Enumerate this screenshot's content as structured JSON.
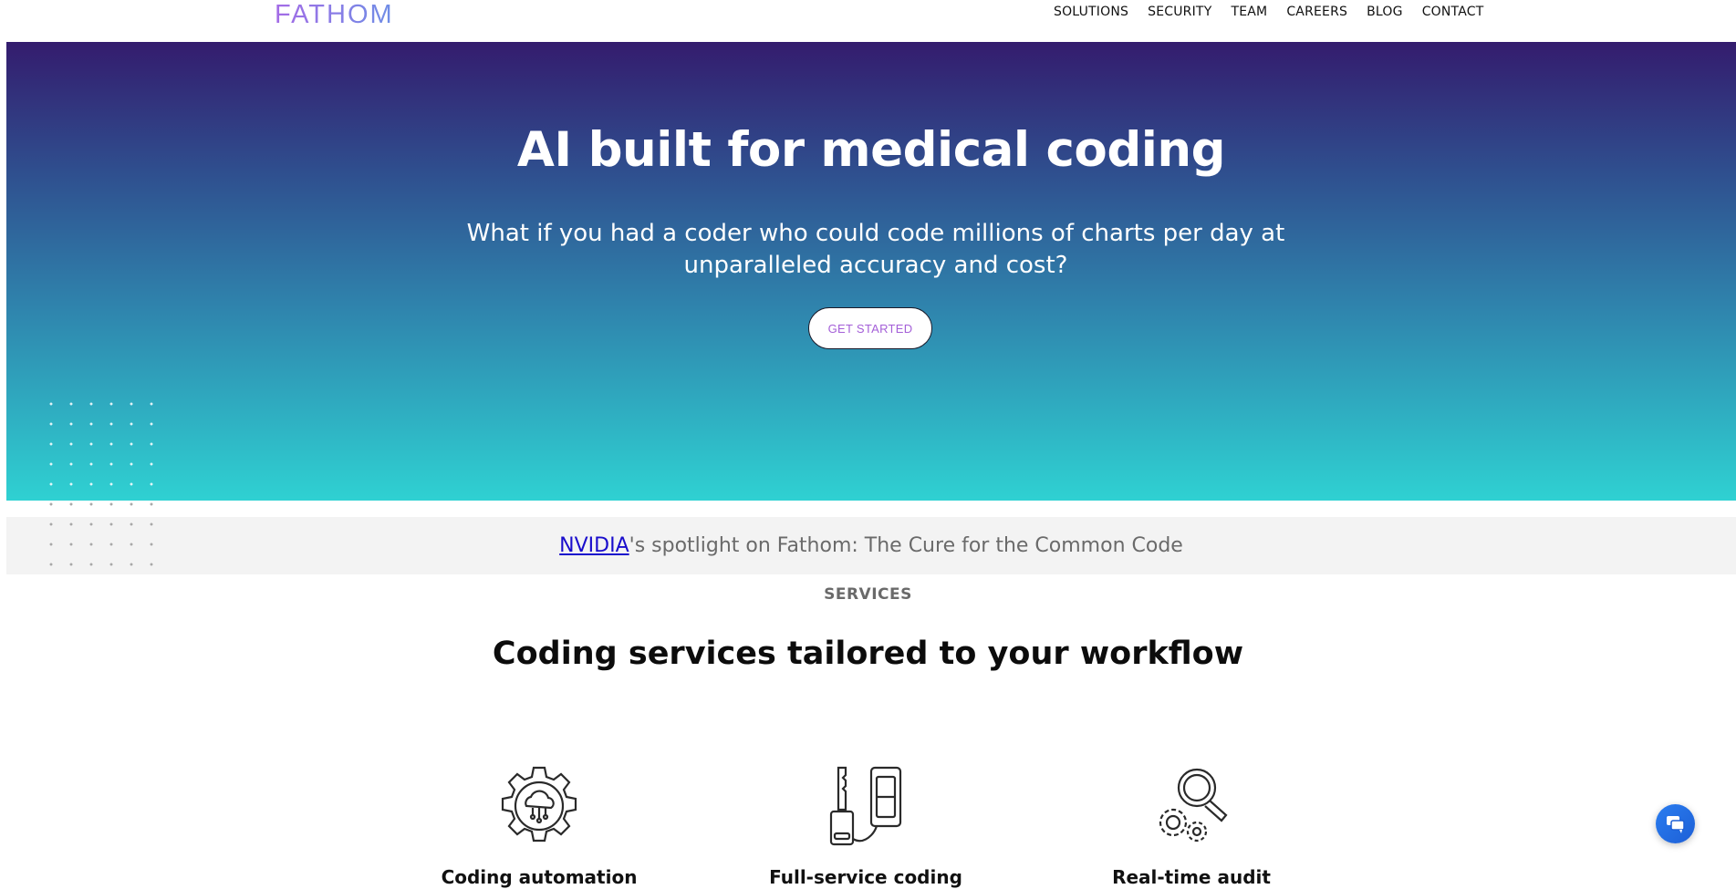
{
  "header": {
    "logo": "FATHOM",
    "nav": [
      "SOLUTIONS",
      "SECURITY",
      "TEAM",
      "CAREERS",
      "BLOG",
      "CONTACT"
    ]
  },
  "hero": {
    "title": "AI built for medical coding",
    "subtitle": "What if you had a coder who could code millions of charts per day at unparalleled accuracy and cost?",
    "cta": "GET STARTED"
  },
  "banner": {
    "link_text": "NVIDIA",
    "text": "'s spotlight on Fathom: The Cure for the Common Code"
  },
  "services": {
    "label": "SERVICES",
    "title": "Coding services tailored to your workflow",
    "items": [
      {
        "label": "Coding automation",
        "icon": "cloud-gear-icon"
      },
      {
        "label": "Full-service coding",
        "icon": "key-lock-icon"
      },
      {
        "label": "Real-time audit",
        "icon": "magnifier-gears-icon"
      }
    ]
  },
  "colors": {
    "hero_top": "#341c6e",
    "hero_bottom": "#2fd1d2",
    "cta_text": "#a45fd8",
    "link": "#1a0dcc",
    "chat": "#2a7df0"
  },
  "chat_widget": {
    "icon": "chat-bubble-icon"
  }
}
